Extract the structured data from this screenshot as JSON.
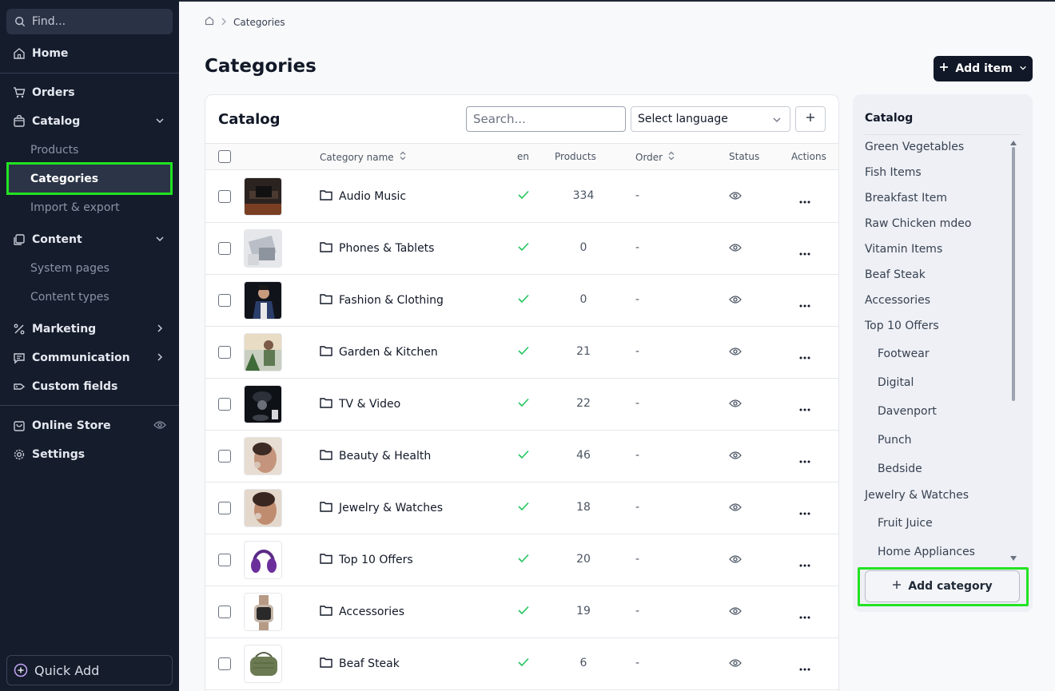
{
  "sidebar": {
    "find_placeholder": "Find...",
    "home": "Home",
    "orders": "Orders",
    "catalog": "Catalog",
    "catalog_children": [
      "Products",
      "Categories",
      "Import & export"
    ],
    "content": "Content",
    "content_children": [
      "System pages",
      "Content types"
    ],
    "marketing": "Marketing",
    "communication": "Communication",
    "custom_fields": "Custom fields",
    "online_store": "Online Store",
    "settings": "Settings",
    "quick_add": "Quick Add",
    "active_item": "Categories"
  },
  "breadcrumb": {
    "current": "Categories"
  },
  "page": {
    "title": "Categories",
    "add_item_label": "Add item"
  },
  "table_card": {
    "title": "Catalog",
    "search_placeholder": "Search...",
    "language_select": "Select language",
    "columns": {
      "name": "Category name",
      "lang": "en",
      "products": "Products",
      "order": "Order",
      "status": "Status",
      "actions": "Actions"
    },
    "rows": [
      {
        "name": "Audio Music",
        "products": "334",
        "order": "-",
        "thumb": "audio"
      },
      {
        "name": "Phones & Tablets",
        "products": "0",
        "order": "-",
        "thumb": "phones"
      },
      {
        "name": "Fashion & Clothing",
        "products": "0",
        "order": "-",
        "thumb": "fashion"
      },
      {
        "name": "Garden & Kitchen",
        "products": "21",
        "order": "-",
        "thumb": "garden"
      },
      {
        "name": "TV & Video",
        "products": "22",
        "order": "-",
        "thumb": "tv"
      },
      {
        "name": "Beauty & Health",
        "products": "46",
        "order": "-",
        "thumb": "beauty"
      },
      {
        "name": "Jewelry & Watches",
        "products": "18",
        "order": "-",
        "thumb": "jewelry"
      },
      {
        "name": "Top 10 Offers",
        "products": "20",
        "order": "-",
        "thumb": "headphones"
      },
      {
        "name": "Accessories",
        "products": "19",
        "order": "-",
        "thumb": "watch"
      },
      {
        "name": "Beaf Steak",
        "products": "6",
        "order": "-",
        "thumb": "speaker"
      }
    ]
  },
  "catalog_panel": {
    "title": "Catalog",
    "items": [
      {
        "label": "Green Vegetables",
        "level": 0
      },
      {
        "label": "Fish Items",
        "level": 0
      },
      {
        "label": "Breakfast Item",
        "level": 0
      },
      {
        "label": "Raw Chicken mdeo",
        "level": 0
      },
      {
        "label": "Vitamin Items",
        "level": 0
      },
      {
        "label": "Beaf Steak",
        "level": 0
      },
      {
        "label": "Accessories",
        "level": 0
      },
      {
        "label": "Top 10 Offers",
        "level": 0
      },
      {
        "label": "Footwear",
        "level": 1
      },
      {
        "label": "Digital",
        "level": 1
      },
      {
        "label": "Davenport",
        "level": 1
      },
      {
        "label": "Punch",
        "level": 1
      },
      {
        "label": "Bedside",
        "level": 1
      },
      {
        "label": "Jewelry & Watches",
        "level": 0
      },
      {
        "label": "Fruit Juice",
        "level": 1
      },
      {
        "label": "Home Appliances",
        "level": 1
      }
    ],
    "add_category_label": "Add category"
  },
  "colors": {
    "sidebar_bg": "#151c2c",
    "highlight": "#22e322",
    "check": "#22c55e",
    "primary_button": "#111827"
  }
}
